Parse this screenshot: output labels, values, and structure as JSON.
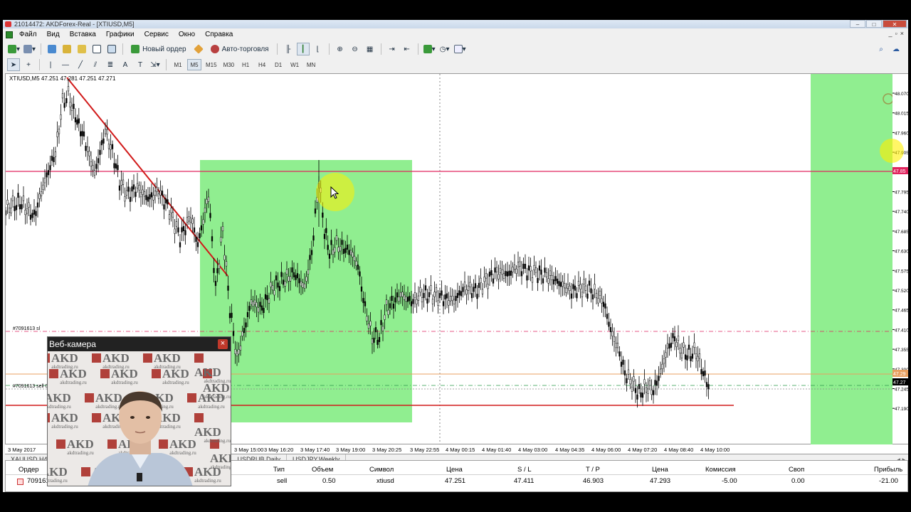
{
  "window": {
    "title": "21014472: AKDForex-Real - [XTIUSD,M5]"
  },
  "menu": [
    "Файл",
    "Вид",
    "Вставка",
    "Графики",
    "Сервис",
    "Окно",
    "Справка"
  ],
  "toolbar": {
    "new_order_label": "Новый ордер",
    "auto_trading_label": "Авто-торговля"
  },
  "timeframes": [
    "M1",
    "M5",
    "M15",
    "M30",
    "H1",
    "H4",
    "D1",
    "W1",
    "MN"
  ],
  "active_timeframe": "M5",
  "chart": {
    "symbol_info": "XTIUSD,M5  47.251 47.281 47.251 47.271",
    "order_label_sl": "#7091613 sl",
    "order_label_sell": "#7091613 sell 0",
    "colors": {
      "highlight": "#90ee90",
      "level_line": "#e0245e",
      "trend_line": "#d11a1a",
      "price_bg": "#e0245e"
    }
  },
  "chart_data": {
    "type": "candlestick",
    "symbol": "XTIUSD",
    "timeframe": "M5",
    "price_ticks": [
      "48.070",
      "48.015",
      "47.960",
      "47.905",
      "47.850",
      "47.795",
      "47.740",
      "47.685",
      "47.630",
      "47.575",
      "47.520",
      "47.465",
      "47.410",
      "47.355",
      "47.300",
      "47.245",
      "47.190"
    ],
    "price_labels": {
      "level": "47.85",
      "orange": "47.29",
      "current": "47.27"
    },
    "time_ticks": [
      "3 May 2017",
      "3 May 15:00",
      "3 May 16:20",
      "3 May 17:40",
      "3 May 19:00",
      "3 May 20:25",
      "3 May 22:55",
      "4 May 00:15",
      "4 May 01:40",
      "4 May 03:00",
      "4 May 04:35",
      "4 May 06:00",
      "4 May 07:20",
      "4 May 08:40",
      "4 May 10:00"
    ]
  },
  "chart_tabs": [
    "XAUUSD,H4",
    "USDRUB,Daily",
    "USDJPY,Weekly"
  ],
  "terminal": {
    "headers": {
      "order": "Ордер",
      "type": "Тип",
      "volume": "Объем",
      "symbol": "Символ",
      "price": "Цена",
      "sl": "S / L",
      "tp": "T / P",
      "price2": "Цена",
      "commission": "Комиссия",
      "swap": "Своп",
      "profit": "Прибыль"
    },
    "row": {
      "order": "709161",
      "type": "sell",
      "volume": "0.50",
      "symbol": "xtiusd",
      "price": "47.251",
      "sl": "47.411",
      "tp": "46.903",
      "price2": "47.293",
      "commission": "-5.00",
      "swap": "0.00",
      "profit": "-21.00"
    }
  },
  "webcam": {
    "title": "Веб-камера",
    "watermark_text": "AKD",
    "watermark_sub": "akdtrading.ru"
  }
}
